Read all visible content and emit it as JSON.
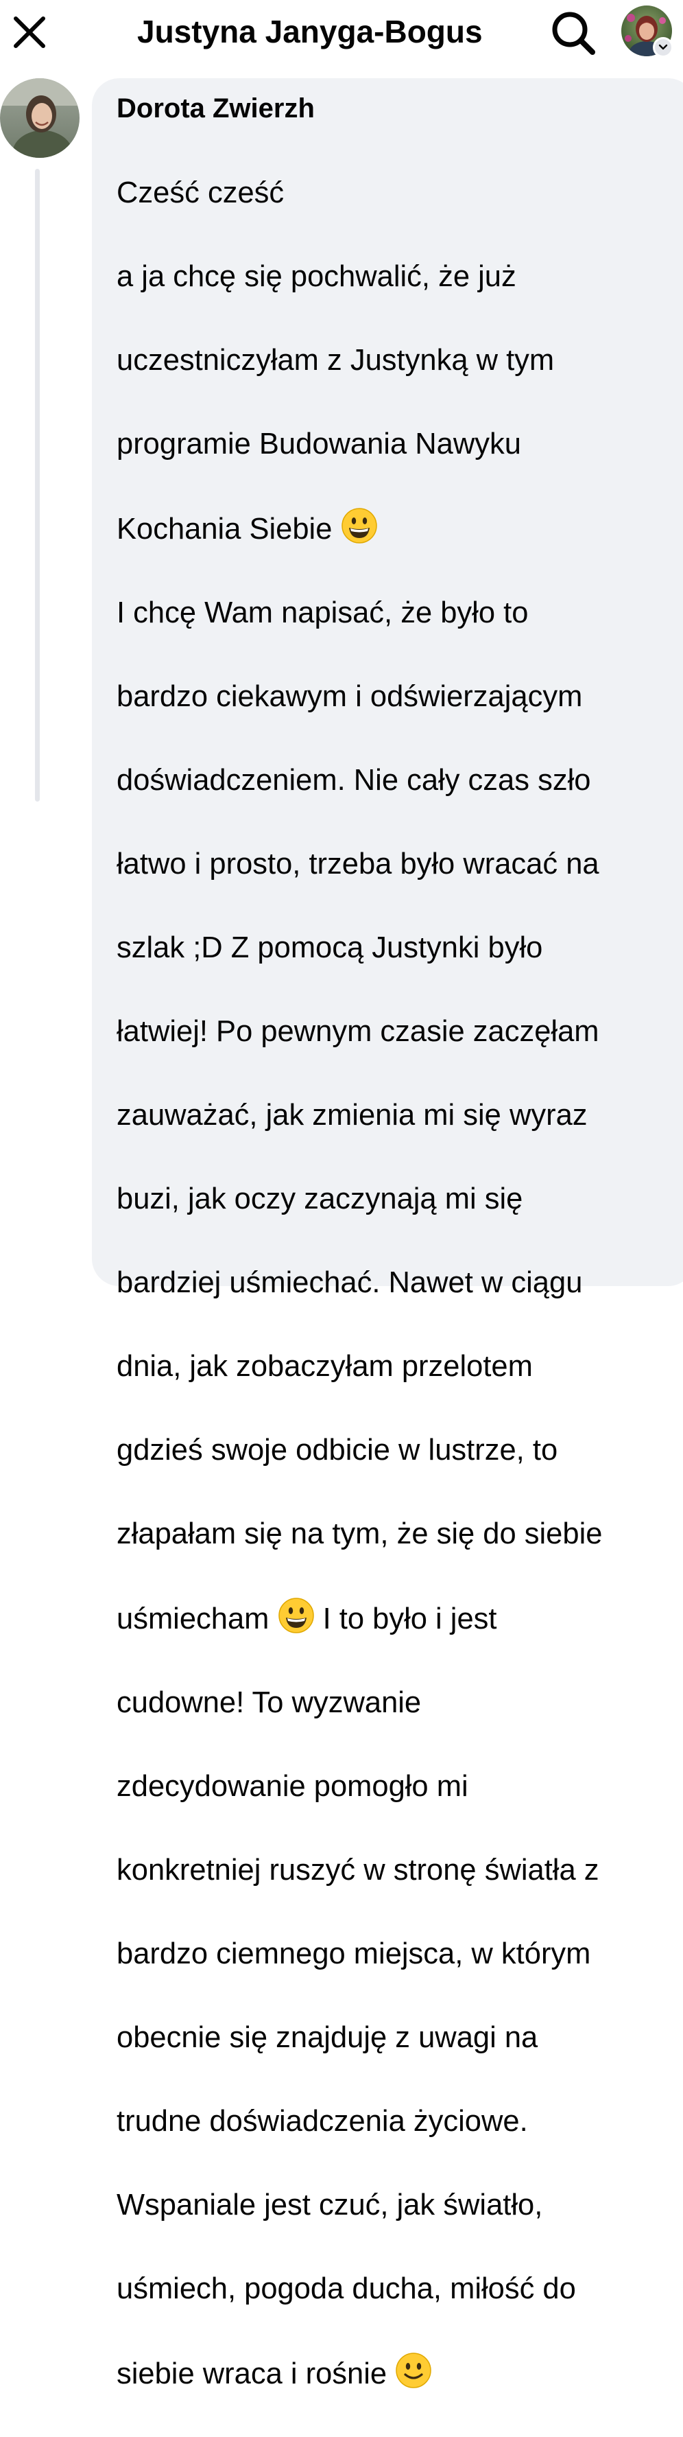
{
  "header": {
    "title": "Justyna Janyga-Bogus",
    "close_icon": "close-icon",
    "search_icon": "search-icon",
    "chevron_icon": "chevron-down-icon"
  },
  "comment": {
    "author": "Dorota Zwierzh",
    "lines": [
      "Cześć cześć",
      "a ja chcę się pochwalić, że już",
      "uczestniczyłam z Justynką w tym",
      "programie Budowania Nawyku",
      "Kochania Siebie",
      "I chcę Wam napisać, że było to",
      "bardzo ciekawym i odświerzającym",
      "doświadczeniem. Nie cały czas szło",
      "łatwo i prosto, trzeba było wracać na",
      "szlak ;D Z pomocą Justynki było",
      "łatwiej! Po pewnym czasie zaczęłam",
      "zauważać, jak zmienia mi się wyraz",
      "buzi, jak oczy zaczynają mi się",
      "bardziej uśmiechać. Nawet w ciągu",
      "dnia, jak zobaczyłam przelotem",
      "gdzieś swoje odbicie w lustrze, to",
      "złapałam się na tym, że się do siebie",
      "uśmiecham",
      "I to było i jest",
      "cudowne! To wyzwanie",
      "zdecydowanie pomogło mi",
      "konkretniej ruszyć w stronę światła z",
      "bardzo ciemnego miejsca, w którym",
      "obecnie się znajduję z uwagi na",
      "trudne doświadczenia życiowe.",
      "Wspaniale jest czuć, jak światło,",
      "uśmiech, pogoda ducha, miłość do",
      "siebie wraca i rośnie"
    ],
    "emojis": [
      "grinning-face-emoji",
      "grinning-face-emoji",
      "slightly-smiling-face-emoji"
    ]
  },
  "colors": {
    "bubble": "#f0f2f5",
    "text": "#050505",
    "thread_line": "#e4e6eb",
    "emoji_yellow": "#ffcc33"
  }
}
